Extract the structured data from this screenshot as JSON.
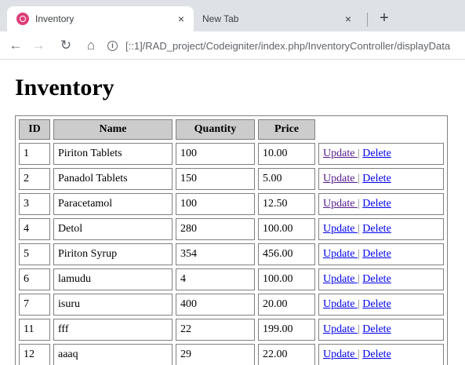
{
  "browser": {
    "tabs": [
      {
        "title": "Inventory",
        "active": true
      },
      {
        "title": "New Tab",
        "active": false
      }
    ],
    "new_tab_symbol": "+",
    "close_symbol": "×",
    "url": "[::1]/RAD_project/Codeigniter/index.php/InventoryController/displayData"
  },
  "page": {
    "title": "Inventory",
    "table": {
      "headers": [
        "ID",
        "Name",
        "Quantity",
        "Price"
      ],
      "update_label": "Update ",
      "separator": "|",
      "delete_label": "Delete",
      "rows": [
        {
          "id": "1",
          "name": "Piriton Tablets",
          "quantity": "100",
          "price": "10.00"
        },
        {
          "id": "2",
          "name": "Panadol Tablets",
          "quantity": "150",
          "price": "5.00"
        },
        {
          "id": "3",
          "name": "Paracetamol",
          "quantity": "100",
          "price": "12.50"
        },
        {
          "id": "4",
          "name": "Detol",
          "quantity": "280",
          "price": "100.00"
        },
        {
          "id": "5",
          "name": "Piriton Syrup",
          "quantity": "354",
          "price": "456.00"
        },
        {
          "id": "6",
          "name": "lamudu",
          "quantity": "4",
          "price": "100.00"
        },
        {
          "id": "7",
          "name": "isuru",
          "quantity": "400",
          "price": "20.00"
        },
        {
          "id": "11",
          "name": "fff",
          "quantity": "22",
          "price": "199.00"
        },
        {
          "id": "12",
          "name": "aaaq",
          "quantity": "29",
          "price": "22.00"
        }
      ]
    }
  },
  "colors": {
    "favicon": "#dd3f79",
    "link": "#0000ee",
    "visited_link": "#551a8b",
    "header_bg": "#cccccc"
  },
  "icons": {
    "back": "arrow-left-icon",
    "forward": "arrow-right-icon",
    "reload": "reload-icon",
    "home": "home-icon",
    "info": "info-icon"
  }
}
